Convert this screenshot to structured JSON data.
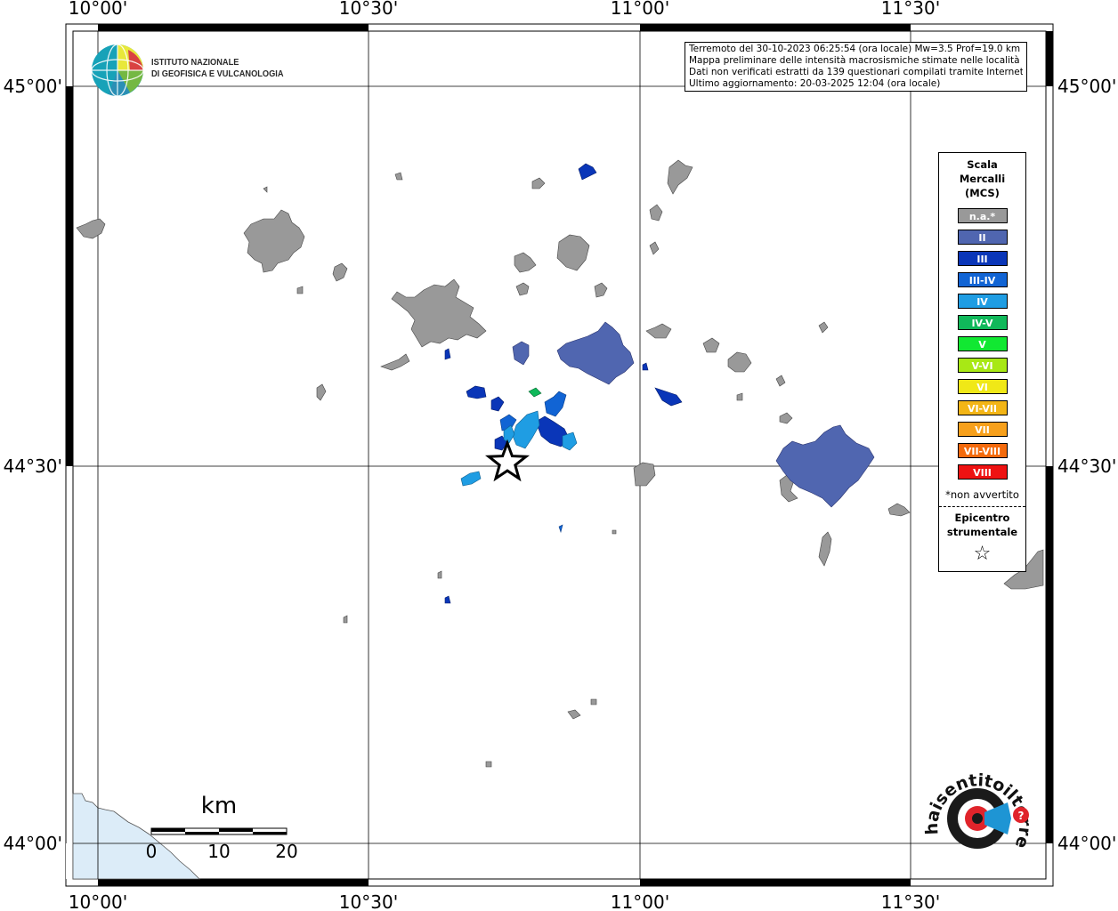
{
  "info": {
    "line1": "Terremoto del 30-10-2023 06:25:54 (ora locale) Mw=3.5 Prof=19.0 km",
    "line2": "Mappa preliminare delle intensità macrosismiche stimate nelle località",
    "line3": "Dati non verificati estratti da 139 questionari compilati tramite Internet.",
    "line4": "Ultimo aggiornamento: 20-03-2025 12:04 (ora locale)"
  },
  "institute": {
    "line1": "ISTITUTO NAZIONALE",
    "line2": "DI GEOFISICA E VULCANOLOGIA"
  },
  "coords": {
    "top": [
      "10°00'",
      "10°30'",
      "11°00'",
      "11°30'"
    ],
    "bottom": [
      "10°00'",
      "10°30'",
      "11°00'",
      "11°30'"
    ],
    "left": [
      "45°00'",
      "44°30'",
      "44°00'"
    ],
    "right": [
      "45°00'",
      "44°30'",
      "44°00'"
    ]
  },
  "legend": {
    "title1": "Scala",
    "title2": "Mercalli",
    "title3": "(MCS)",
    "items": [
      {
        "label": "n.a.*",
        "color": "#999999"
      },
      {
        "label": "II",
        "color": "#5066b0"
      },
      {
        "label": "III",
        "color": "#0a36b8"
      },
      {
        "label": "III-IV",
        "color": "#1164d4"
      },
      {
        "label": "IV",
        "color": "#1f9de3"
      },
      {
        "label": "IV-V",
        "color": "#10b85a"
      },
      {
        "label": "V",
        "color": "#11e832"
      },
      {
        "label": "V-VI",
        "color": "#a8e815"
      },
      {
        "label": "VI",
        "color": "#f0e817"
      },
      {
        "label": "VI-VII",
        "color": "#f3b516"
      },
      {
        "label": "VII",
        "color": "#f7a01b"
      },
      {
        "label": "VII-VIII",
        "color": "#f46a0c"
      },
      {
        "label": "VIII",
        "color": "#ee1212"
      }
    ],
    "note": "*non avvertito",
    "epicenter1": "Epicentro",
    "epicenter2": "strumentale",
    "star": "☆"
  },
  "scalebar": {
    "unit": "km",
    "labels": [
      "0",
      "10",
      "20"
    ]
  },
  "logo_site": "haisentitoilterremoto.it",
  "colors": {
    "na": "#999999",
    "II": "#5066b0",
    "III": "#0a36b8",
    "IIIIV": "#1164d4",
    "IV": "#1f9de3",
    "IVV": "#10b85a",
    "sea": "#dcecf8"
  }
}
